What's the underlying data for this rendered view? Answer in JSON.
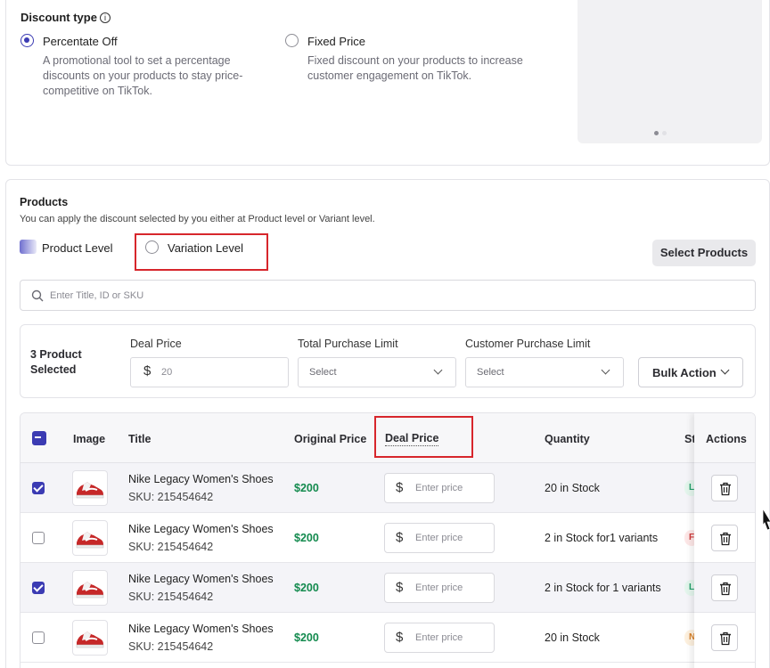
{
  "discount": {
    "title": "Discount type",
    "options": [
      {
        "label": "Percentate Off",
        "checked": true,
        "desc": [
          "A promotional tool to set a percentage",
          "discounts on your products to stay price-",
          "competitive on TikTok."
        ]
      },
      {
        "label": "Fixed Price",
        "checked": false,
        "desc": [
          "Fixed discount on your products to increase",
          "customer engagement on TikTok."
        ]
      }
    ]
  },
  "products": {
    "title": "Products",
    "subtitle": "You can apply the discount selected by you either at Product level or Variant level.",
    "level_product": "Product Level",
    "level_variation": "Variation Level",
    "select_button": "Select Products",
    "search_placeholder": "Enter Title, ID or SKU"
  },
  "bulk": {
    "selected_count": "3 Product Selected",
    "deal_price_label": "Deal Price",
    "deal_price_placeholder": "20",
    "total_limit_label": "Total Purchase Limit",
    "customer_limit_label": "Customer Purchase Limit",
    "select_placeholder": "Select",
    "bulk_action": "Bulk Action"
  },
  "table": {
    "headers": {
      "image": "Image",
      "title": "Title",
      "original_price": "Original Price",
      "deal_price": "Deal Price",
      "quantity": "Quantity",
      "status": "St",
      "actions": "Actions"
    },
    "price_placeholder": "Enter price",
    "rows": [
      {
        "checked": true,
        "name": "Nike Legacy Women's Shoes",
        "sku": "SKU: 215454642",
        "price": "$200",
        "quantity": "20 in Stock",
        "status_letter": "L",
        "status_color": "#22a06b",
        "status_bg": "#e3f5ec"
      },
      {
        "checked": false,
        "name": "Nike Legacy Women's Shoes",
        "sku": "SKU: 215454642",
        "price": "$200",
        "quantity": "2 in Stock for1 variants",
        "status_letter": "F",
        "status_color": "#d03a3a",
        "status_bg": "#fde7e7"
      },
      {
        "checked": true,
        "name": "Nike Legacy Women's Shoes",
        "sku": "SKU: 215454642",
        "price": "$200",
        "quantity": "2 in Stock for 1 variants",
        "status_letter": "L",
        "status_color": "#22a06b",
        "status_bg": "#e3f5ec"
      },
      {
        "checked": false,
        "name": "Nike Legacy Women's Shoes",
        "sku": "SKU: 215454642",
        "price": "$200",
        "quantity": "20 in Stock",
        "status_letter": "N",
        "status_color": "#d9822b",
        "status_bg": "#fdf0de"
      }
    ]
  },
  "colors": {
    "accent": "#3b3bb3",
    "price_green": "#138a4e",
    "highlight_red": "#d7262c"
  }
}
